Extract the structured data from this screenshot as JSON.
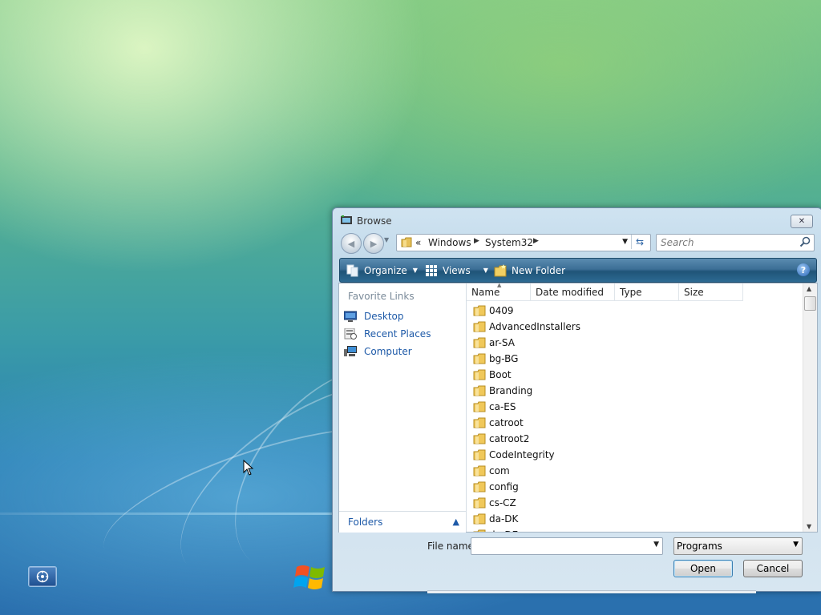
{
  "desktop": {
    "show_desktop_icon": "show-desktop-icon",
    "start_logo_icon": "windows-logo-icon",
    "cursor_icon": "mouse-pointer-icon"
  },
  "dialog": {
    "title": "Browse",
    "close_glyph": "✕",
    "address": {
      "overflow_chevron": "«",
      "segments": [
        "Windows",
        "System32"
      ]
    },
    "search": {
      "placeholder": "Search"
    },
    "toolbar": {
      "organize": "Organize",
      "views": "Views",
      "new_folder": "New Folder",
      "help": "?"
    },
    "favorites": {
      "title": "Favorite Links",
      "items": [
        "Desktop",
        "Recent Places",
        "Computer"
      ]
    },
    "folders_label": "Folders",
    "columns": [
      "Name",
      "Date modified",
      "Type",
      "Size"
    ],
    "files": [
      "0409",
      "AdvancedInstallers",
      "ar-SA",
      "bg-BG",
      "Boot",
      "Branding",
      "ca-ES",
      "catroot",
      "catroot2",
      "CodeIntegrity",
      "com",
      "config",
      "cs-CZ",
      "da-DK",
      "de-DE"
    ],
    "file_name": {
      "label": "File name:",
      "value": ""
    },
    "file_type": "Programs",
    "buttons": {
      "open": "Open",
      "cancel": "Cancel"
    }
  },
  "colors": {
    "toolbar": "#2d6a92",
    "link": "#1e5aa8",
    "dialog_frame": "#c4dbeb"
  }
}
